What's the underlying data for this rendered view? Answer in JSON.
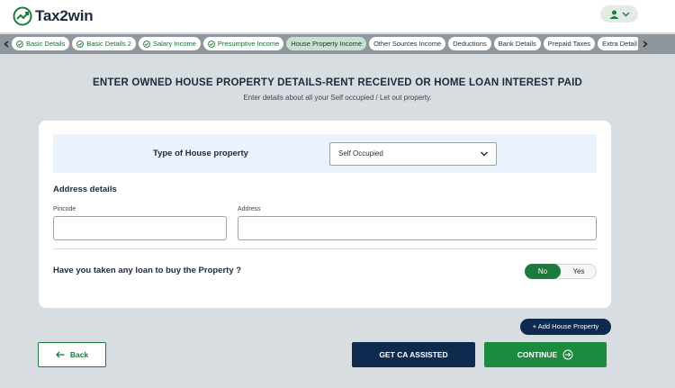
{
  "header": {
    "logo_text": "Tax2win"
  },
  "tabs": [
    {
      "label": "Basic Details",
      "state": "done"
    },
    {
      "label": "Basic Details 2",
      "state": "done"
    },
    {
      "label": "Salary Income",
      "state": "done"
    },
    {
      "label": "Presumptive Income",
      "state": "done"
    },
    {
      "label": "House Property Income",
      "state": "active"
    },
    {
      "label": "Other Sources Income",
      "state": "todo"
    },
    {
      "label": "Deductions",
      "state": "todo"
    },
    {
      "label": "Bank Details",
      "state": "todo"
    },
    {
      "label": "Prepaid Taxes",
      "state": "todo"
    },
    {
      "label": "Extra Detail",
      "state": "todo"
    }
  ],
  "main": {
    "title": "ENTER OWNED HOUSE PROPERTY DETAILS-RENT RECEIVED OR HOME LOAN INTEREST PAID",
    "subtitle": "Enter details about all your Self occupied / Let out property."
  },
  "form": {
    "type_label": "Type of House property",
    "type_value": "Self Occupied",
    "address_heading": "Address details",
    "pincode_label": "Pincode",
    "pincode_value": "",
    "address_label": "Address",
    "address_value": "",
    "loan_question": "Have you taken any loan to buy the Property ?",
    "loan_no": "No",
    "loan_yes": "Yes",
    "loan_selected": "No"
  },
  "actions": {
    "add_property": "+ Add House Property",
    "back": "Back",
    "ca_assisted": "GET CA ASSISTED",
    "continue": "CONTINUE"
  },
  "colors": {
    "brand_green": "#1c7a3c",
    "navy": "#0e2a4e",
    "background": "#d8dde1"
  }
}
